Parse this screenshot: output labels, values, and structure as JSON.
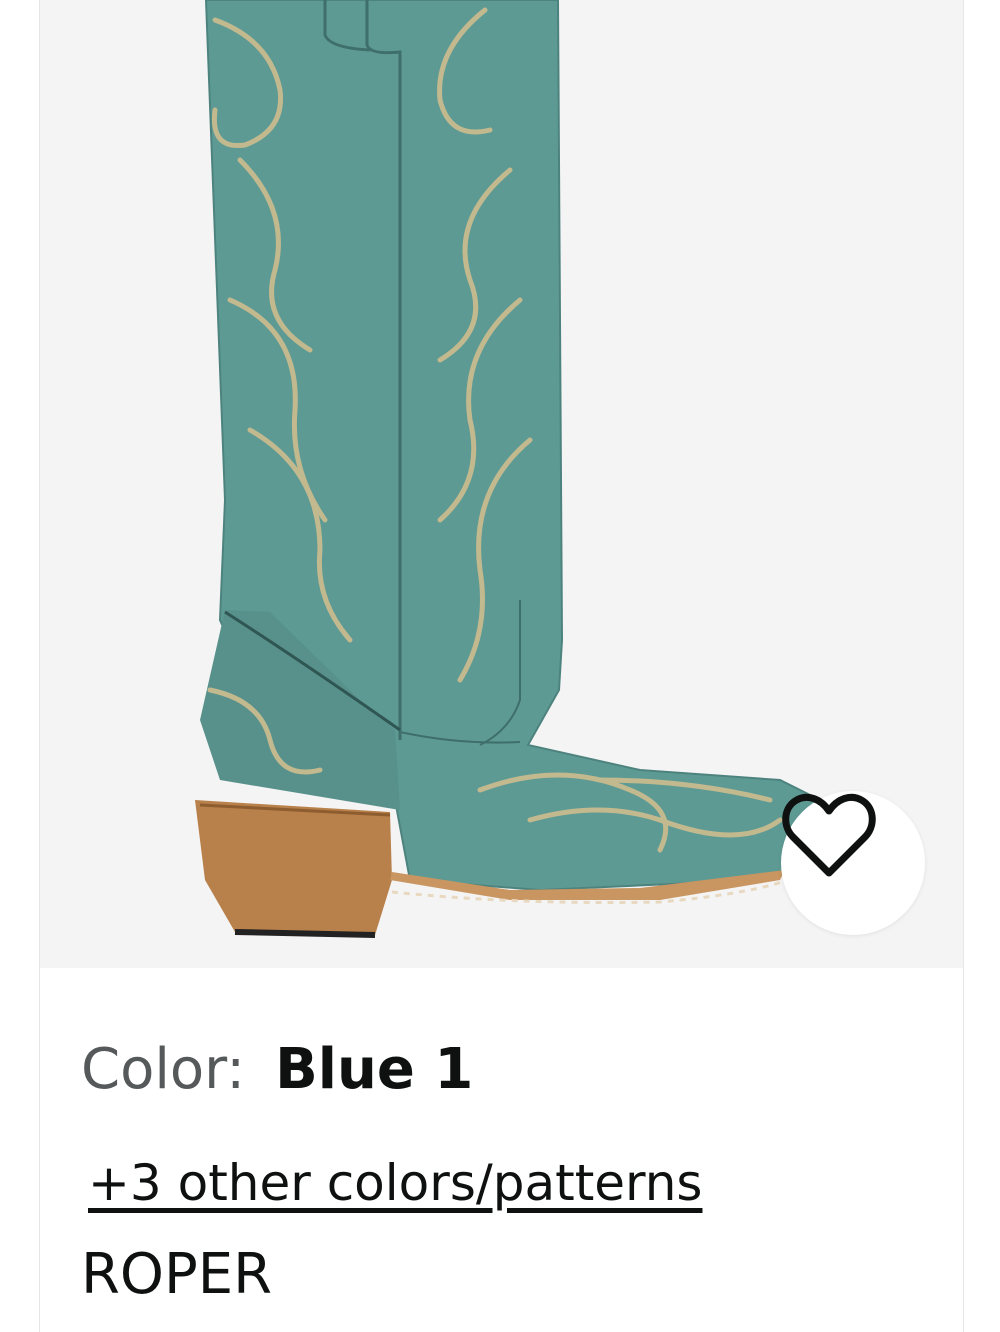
{
  "product": {
    "color_label": "Color:",
    "color_value": "Blue 1",
    "other_colors_link": "+3 other colors/patterns",
    "brand": "ROPER"
  },
  "icons": {
    "wishlist": "heart-outline-icon"
  },
  "colors": {
    "boot_leather": "#5e9a94",
    "stitching": "#c2b98e",
    "heel_wood": "#b8804a",
    "image_bg": "#f4f4f4"
  }
}
